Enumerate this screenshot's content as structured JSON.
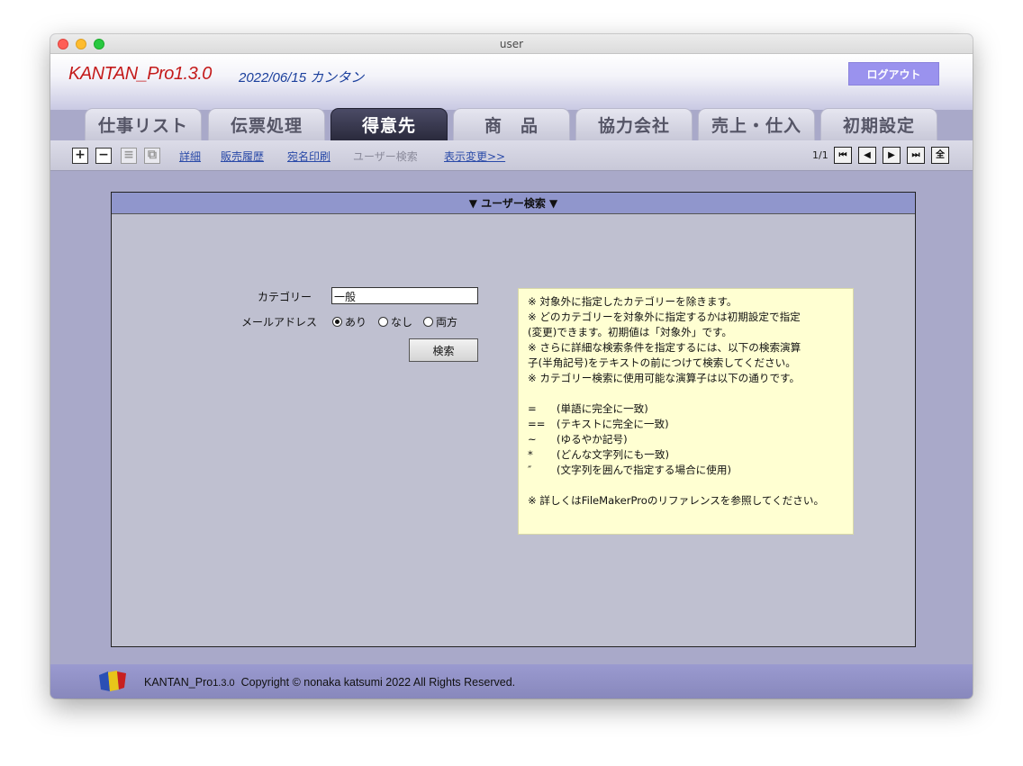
{
  "window": {
    "title": "user"
  },
  "header": {
    "app_title": "KANTAN_Pro1.3.0",
    "date_text": "2022/06/15 カンタン",
    "logout_label": "ログアウト"
  },
  "tabs": [
    {
      "label": "仕事リスト",
      "active": false
    },
    {
      "label": "伝票処理",
      "active": false
    },
    {
      "label": "得意先",
      "active": true
    },
    {
      "label": "商　品",
      "active": false
    },
    {
      "label": "協力会社",
      "active": false
    },
    {
      "label": "売上・仕入",
      "active": false
    },
    {
      "label": "初期設定",
      "active": false
    }
  ],
  "toolbar": {
    "add_icon": "+",
    "remove_icon": "−",
    "list_icon": "≡",
    "copy_icon": "⧉",
    "links": [
      "詳細",
      "販売履歴",
      "宛名印刷",
      "ユーザー検索",
      "表示変更>>"
    ],
    "record_counter": "1/1",
    "nav_first": "⏮",
    "nav_prev": "◀",
    "nav_next": "▶",
    "nav_last": "⏭",
    "all_label": "全"
  },
  "panel": {
    "heading": "▼ ユーザー検索 ▼",
    "category_label": "カテゴリー",
    "category_value": "一般",
    "mail_label": "メールアドレス",
    "mail_options": [
      "あり",
      "なし",
      "両方"
    ],
    "mail_selected": "あり",
    "search_button": "検索"
  },
  "note": {
    "lines": [
      "※ 対象外に指定したカテゴリーを除きます。",
      "※ どのカテゴリーを対象外に指定するかは初期設定で指定",
      "(変更)できます。初期値は「対象外」です。",
      "※ さらに詳細な検索条件を指定するには、以下の検索演算",
      "子(半角記号)をテキストの前につけて検索してください。",
      "※ カテゴリー検索に使用可能な演算子は以下の通りです。"
    ],
    "operators": [
      {
        "sym": "=",
        "desc": "(単語に完全に一致)"
      },
      {
        "sym": "==",
        "desc": "(テキストに完全に一致)"
      },
      {
        "sym": "~",
        "desc": "(ゆるやか記号)"
      },
      {
        "sym": "*",
        "desc": "(どんな文字列にも一致)"
      },
      {
        "sym": "″",
        "desc": "(文字列を囲んで指定する場合に使用)"
      }
    ],
    "footer_line": "※ 詳しくはFileMakerProのリファレンスを参照してください。"
  },
  "footer": {
    "brand": "KANTAN_Pro",
    "version": "1.3.0",
    "copyright": "Copyright © nonaka katsumi 2022 All Rights Reserved."
  },
  "colors": {
    "title_red": "#c41a1a",
    "date_blue": "#1a3f9c",
    "logout_bg": "#9a92ee",
    "active_tab": "#2a2a3c",
    "panel_head": "#9096cc",
    "note_bg": "#ffffd2"
  }
}
